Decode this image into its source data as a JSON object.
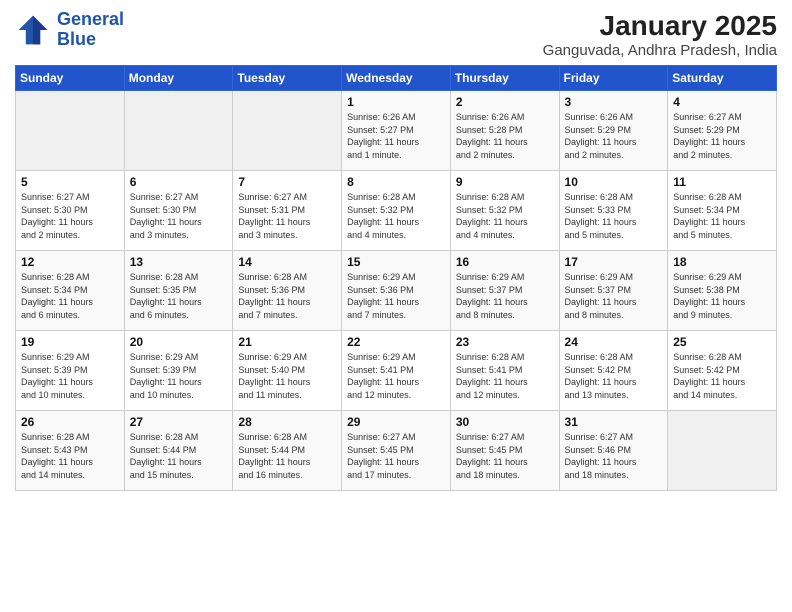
{
  "header": {
    "logo_line1": "General",
    "logo_line2": "Blue",
    "title": "January 2025",
    "subtitle": "Ganguvada, Andhra Pradesh, India"
  },
  "weekdays": [
    "Sunday",
    "Monday",
    "Tuesday",
    "Wednesday",
    "Thursday",
    "Friday",
    "Saturday"
  ],
  "weeks": [
    [
      {
        "day": "",
        "info": ""
      },
      {
        "day": "",
        "info": ""
      },
      {
        "day": "",
        "info": ""
      },
      {
        "day": "1",
        "info": "Sunrise: 6:26 AM\nSunset: 5:27 PM\nDaylight: 11 hours\nand 1 minute."
      },
      {
        "day": "2",
        "info": "Sunrise: 6:26 AM\nSunset: 5:28 PM\nDaylight: 11 hours\nand 2 minutes."
      },
      {
        "day": "3",
        "info": "Sunrise: 6:26 AM\nSunset: 5:29 PM\nDaylight: 11 hours\nand 2 minutes."
      },
      {
        "day": "4",
        "info": "Sunrise: 6:27 AM\nSunset: 5:29 PM\nDaylight: 11 hours\nand 2 minutes."
      }
    ],
    [
      {
        "day": "5",
        "info": "Sunrise: 6:27 AM\nSunset: 5:30 PM\nDaylight: 11 hours\nand 2 minutes."
      },
      {
        "day": "6",
        "info": "Sunrise: 6:27 AM\nSunset: 5:30 PM\nDaylight: 11 hours\nand 3 minutes."
      },
      {
        "day": "7",
        "info": "Sunrise: 6:27 AM\nSunset: 5:31 PM\nDaylight: 11 hours\nand 3 minutes."
      },
      {
        "day": "8",
        "info": "Sunrise: 6:28 AM\nSunset: 5:32 PM\nDaylight: 11 hours\nand 4 minutes."
      },
      {
        "day": "9",
        "info": "Sunrise: 6:28 AM\nSunset: 5:32 PM\nDaylight: 11 hours\nand 4 minutes."
      },
      {
        "day": "10",
        "info": "Sunrise: 6:28 AM\nSunset: 5:33 PM\nDaylight: 11 hours\nand 5 minutes."
      },
      {
        "day": "11",
        "info": "Sunrise: 6:28 AM\nSunset: 5:34 PM\nDaylight: 11 hours\nand 5 minutes."
      }
    ],
    [
      {
        "day": "12",
        "info": "Sunrise: 6:28 AM\nSunset: 5:34 PM\nDaylight: 11 hours\nand 6 minutes."
      },
      {
        "day": "13",
        "info": "Sunrise: 6:28 AM\nSunset: 5:35 PM\nDaylight: 11 hours\nand 6 minutes."
      },
      {
        "day": "14",
        "info": "Sunrise: 6:28 AM\nSunset: 5:36 PM\nDaylight: 11 hours\nand 7 minutes."
      },
      {
        "day": "15",
        "info": "Sunrise: 6:29 AM\nSunset: 5:36 PM\nDaylight: 11 hours\nand 7 minutes."
      },
      {
        "day": "16",
        "info": "Sunrise: 6:29 AM\nSunset: 5:37 PM\nDaylight: 11 hours\nand 8 minutes."
      },
      {
        "day": "17",
        "info": "Sunrise: 6:29 AM\nSunset: 5:37 PM\nDaylight: 11 hours\nand 8 minutes."
      },
      {
        "day": "18",
        "info": "Sunrise: 6:29 AM\nSunset: 5:38 PM\nDaylight: 11 hours\nand 9 minutes."
      }
    ],
    [
      {
        "day": "19",
        "info": "Sunrise: 6:29 AM\nSunset: 5:39 PM\nDaylight: 11 hours\nand 10 minutes."
      },
      {
        "day": "20",
        "info": "Sunrise: 6:29 AM\nSunset: 5:39 PM\nDaylight: 11 hours\nand 10 minutes."
      },
      {
        "day": "21",
        "info": "Sunrise: 6:29 AM\nSunset: 5:40 PM\nDaylight: 11 hours\nand 11 minutes."
      },
      {
        "day": "22",
        "info": "Sunrise: 6:29 AM\nSunset: 5:41 PM\nDaylight: 11 hours\nand 12 minutes."
      },
      {
        "day": "23",
        "info": "Sunrise: 6:28 AM\nSunset: 5:41 PM\nDaylight: 11 hours\nand 12 minutes."
      },
      {
        "day": "24",
        "info": "Sunrise: 6:28 AM\nSunset: 5:42 PM\nDaylight: 11 hours\nand 13 minutes."
      },
      {
        "day": "25",
        "info": "Sunrise: 6:28 AM\nSunset: 5:42 PM\nDaylight: 11 hours\nand 14 minutes."
      }
    ],
    [
      {
        "day": "26",
        "info": "Sunrise: 6:28 AM\nSunset: 5:43 PM\nDaylight: 11 hours\nand 14 minutes."
      },
      {
        "day": "27",
        "info": "Sunrise: 6:28 AM\nSunset: 5:44 PM\nDaylight: 11 hours\nand 15 minutes."
      },
      {
        "day": "28",
        "info": "Sunrise: 6:28 AM\nSunset: 5:44 PM\nDaylight: 11 hours\nand 16 minutes."
      },
      {
        "day": "29",
        "info": "Sunrise: 6:27 AM\nSunset: 5:45 PM\nDaylight: 11 hours\nand 17 minutes."
      },
      {
        "day": "30",
        "info": "Sunrise: 6:27 AM\nSunset: 5:45 PM\nDaylight: 11 hours\nand 18 minutes."
      },
      {
        "day": "31",
        "info": "Sunrise: 6:27 AM\nSunset: 5:46 PM\nDaylight: 11 hours\nand 18 minutes."
      },
      {
        "day": "",
        "info": ""
      }
    ]
  ]
}
